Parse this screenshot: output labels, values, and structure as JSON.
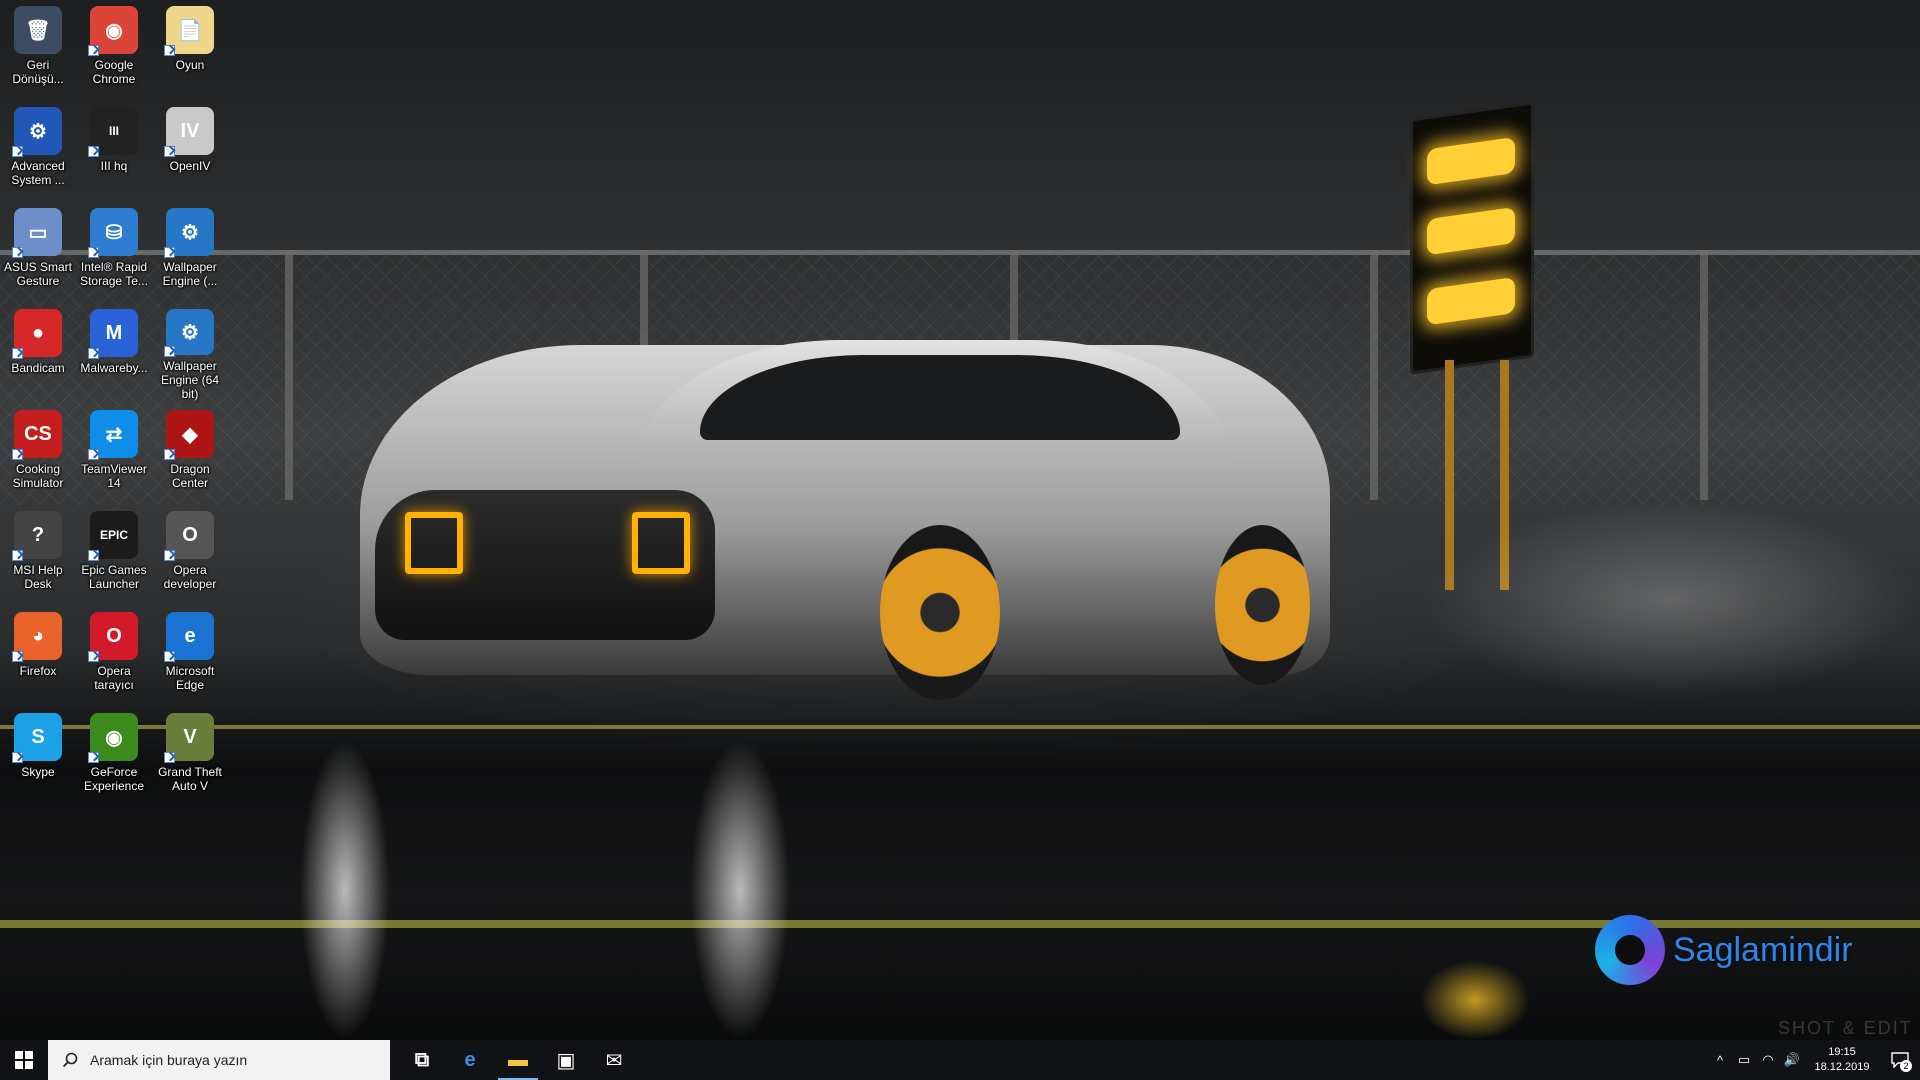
{
  "desktop": {
    "icons": [
      {
        "name": "icon-recycle-bin",
        "label": "Geri\nDönüşü...",
        "glyph": "🗑",
        "bg": "#3b4c63"
      },
      {
        "name": "icon-google-chrome",
        "label": "Google\nChrome",
        "glyph": "◉",
        "bg": "#db4437"
      },
      {
        "name": "icon-oyun",
        "label": "Oyun",
        "glyph": "📄",
        "bg": "#f0d68a"
      },
      {
        "name": "icon-advanced-systemcare",
        "label": "Advanced\nSystem ...",
        "glyph": "⚙",
        "bg": "#2158b8"
      },
      {
        "name": "icon-iii-hq",
        "label": "III hq",
        "glyph": "III",
        "bg": "#222222"
      },
      {
        "name": "icon-openiv",
        "label": "OpenIV",
        "glyph": "IV",
        "bg": "#c9c9c9"
      },
      {
        "name": "icon-asus-smart-gesture",
        "label": "ASUS Smart\nGesture",
        "glyph": "▭",
        "bg": "#6d8fc7"
      },
      {
        "name": "icon-intel-rapid-storage",
        "label": "Intel® Rapid\nStorage Te...",
        "glyph": "⛁",
        "bg": "#2e7dd1"
      },
      {
        "name": "icon-wallpaper-engine",
        "label": "Wallpaper\nEngine (...",
        "glyph": "⚙",
        "bg": "#2876c8"
      },
      {
        "name": "icon-bandicam",
        "label": "Bandicam",
        "glyph": "●",
        "bg": "#d62828"
      },
      {
        "name": "icon-malwarebytes",
        "label": "Malwareby...",
        "glyph": "M",
        "bg": "#2a62d8"
      },
      {
        "name": "icon-wallpaper-engine-64",
        "label": "Wallpaper\nEngine (64\nbit)",
        "glyph": "⚙",
        "bg": "#2876c8"
      },
      {
        "name": "icon-cooking-simulator",
        "label": "Cooking\nSimulator",
        "glyph": "CS",
        "bg": "#c41e1e"
      },
      {
        "name": "icon-teamviewer",
        "label": "TeamViewer\n14",
        "glyph": "⇄",
        "bg": "#0e8ee9"
      },
      {
        "name": "icon-dragon-center",
        "label": "Dragon\nCenter",
        "glyph": "◆",
        "bg": "#b01515"
      },
      {
        "name": "icon-msi-help-desk",
        "label": "MSI Help\nDesk",
        "glyph": "?",
        "bg": "#444444"
      },
      {
        "name": "icon-epic-games",
        "label": "Epic Games\nLauncher",
        "glyph": "EPIC",
        "bg": "#1b1b1b"
      },
      {
        "name": "icon-opera-developer",
        "label": "Opera\ndeveloper",
        "glyph": "O",
        "bg": "#555555"
      },
      {
        "name": "icon-firefox",
        "label": "Firefox",
        "glyph": "◕",
        "bg": "#e8622a"
      },
      {
        "name": "icon-opera",
        "label": "Opera\ntarayıcı",
        "glyph": "O",
        "bg": "#d11a2a"
      },
      {
        "name": "icon-microsoft-edge",
        "label": "Microsoft\nEdge",
        "glyph": "e",
        "bg": "#1a73d1"
      },
      {
        "name": "icon-skype",
        "label": "Skype",
        "glyph": "S",
        "bg": "#1da1e6"
      },
      {
        "name": "icon-geforce-experience",
        "label": "GeForce\nExperience",
        "glyph": "◉",
        "bg": "#3d8b1f"
      },
      {
        "name": "icon-grand-theft-auto-v",
        "label": "Grand Theft\nAuto V",
        "glyph": "V",
        "bg": "#6a7d3a"
      }
    ]
  },
  "watermark": {
    "brand": "Saglamindir",
    "overlay_text": "SHOT & EDIT"
  },
  "taskbar": {
    "search_placeholder": "Aramak için buraya yazın",
    "apps": [
      {
        "name": "taskbar-task-view",
        "glyph": "⧉",
        "color": "#ffffff",
        "active": false
      },
      {
        "name": "taskbar-edge",
        "glyph": "e",
        "color": "#3a8ee6",
        "active": false
      },
      {
        "name": "taskbar-file-explorer",
        "glyph": "▬",
        "color": "#f5c542",
        "active": true
      },
      {
        "name": "taskbar-store",
        "glyph": "▣",
        "color": "#ffffff",
        "active": false
      },
      {
        "name": "taskbar-mail",
        "glyph": "✉",
        "color": "#ffffff",
        "active": false
      }
    ],
    "clock_time": "19:15",
    "clock_date": "18.12.2019",
    "notification_count": "2"
  },
  "colors": {
    "accent": "#2f86ea",
    "taskbar_bg": "#101216"
  }
}
